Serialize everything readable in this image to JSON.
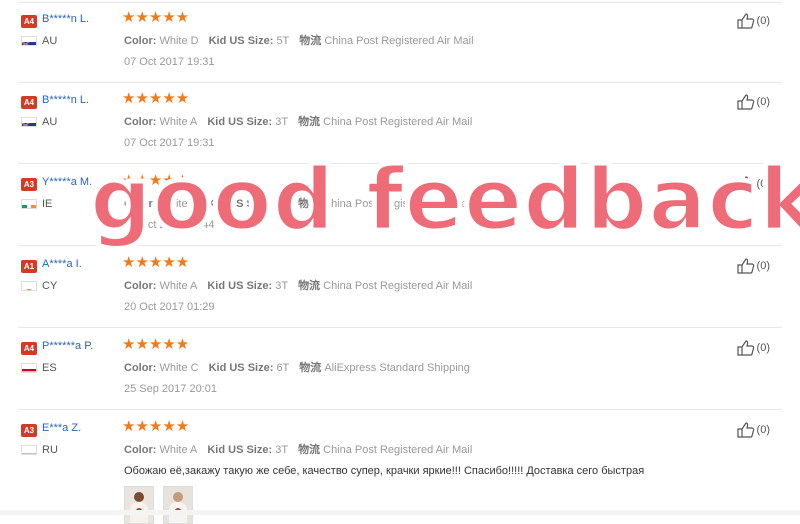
{
  "watermark": "good feedback",
  "labels": {
    "color": "Color:",
    "size": "Kid US Size:",
    "shipping": "物流"
  },
  "colors": {
    "badge": "#d43b26",
    "name": "#2a64b8",
    "stars": "#f27a1a",
    "watermark": "#ee6b78"
  },
  "reviews": [
    {
      "level": "A4",
      "name": "B*****n L.",
      "country": "AU",
      "flag": "au-flag-icon",
      "stars": "★★★★★",
      "color": "White D",
      "size": "5T",
      "shipping": "China Post Registered Air Mail",
      "date": "07 Oct 2017 19:31",
      "likes": "(0)"
    },
    {
      "level": "A4",
      "name": "B*****n L.",
      "country": "AU",
      "flag": "au-flag-icon",
      "stars": "★★★★★",
      "color": "White A",
      "size": "3T",
      "shipping": "China Post Registered Air Mail",
      "date": "07 Oct 2017 19:31",
      "likes": "(0)"
    },
    {
      "level": "A3",
      "name": "Y*****a M.",
      "country": "IE",
      "flag": "ie-flag-icon",
      "stars": "★★★★★",
      "color": "White A",
      "size": "3T",
      "shipping": "China Post Registered Air Mail",
      "date": "20 Oct 2017 19:44",
      "likes": "(0)"
    },
    {
      "level": "A1",
      "name": "A****a I.",
      "country": "CY",
      "flag": "cy-flag-icon",
      "stars": "★★★★★",
      "color": "White A",
      "size": "3T",
      "shipping": "China Post Registered Air Mail",
      "date": "20 Oct 2017 01:29",
      "likes": "(0)"
    },
    {
      "level": "A4",
      "name": "P******a P.",
      "country": "ES",
      "flag": "es-flag-icon",
      "stars": "★★★★★",
      "color": "White C",
      "size": "6T",
      "shipping": "AliExpress Standard Shipping",
      "date": "25 Sep 2017 20:01",
      "likes": "(0)"
    },
    {
      "level": "A3",
      "name": "E***a Z.",
      "country": "RU",
      "flag": "ru-flag-icon",
      "stars": "★★★★★",
      "color": "White A",
      "size": "3T",
      "shipping": "China Post Registered Air Mail",
      "text": "Обожаю её,закажу такую же себе, качество супер, крачки яркие!!! Спасибо!!!!! Доставка сего быстрая",
      "likes": "(0)"
    }
  ]
}
